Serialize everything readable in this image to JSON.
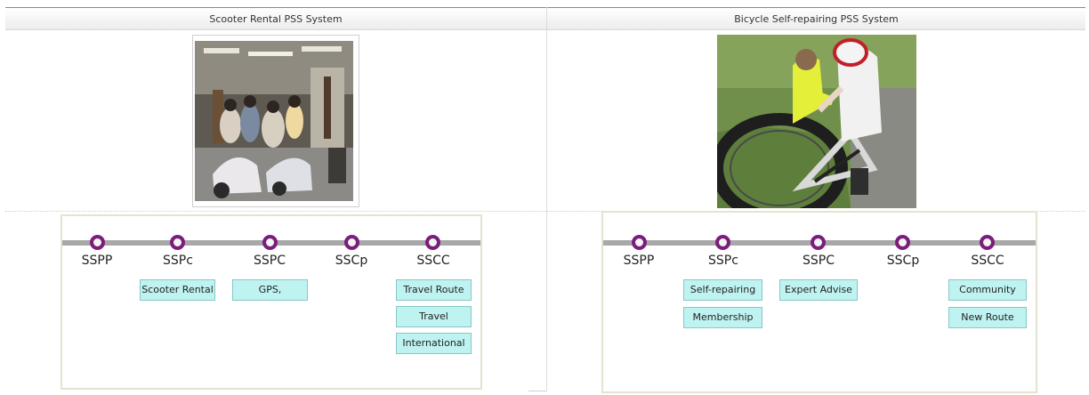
{
  "left_panel": {
    "title": "Scooter Rental PSS System",
    "photo_icon": "scooter-shop-photo",
    "stages": [
      "SSPP",
      "SSPc",
      "SSPC",
      "SSCp",
      "SSCC"
    ],
    "tags": {
      "sspc_small": [
        "Scooter Rental"
      ],
      "sspc_large": [
        "GPS,"
      ],
      "sscc": [
        "Travel Route",
        "Travel",
        "International"
      ]
    }
  },
  "right_panel": {
    "title": "Bicycle Self-repairing PSS System",
    "photo_icon": "bicycle-repair-photo",
    "stages": [
      "SSPP",
      "SSPc",
      "SSPC",
      "SSCp",
      "SSCC"
    ],
    "tags": {
      "sspc_small": [
        "Self-repairing",
        "Membership"
      ],
      "sspc_large": [
        "Expert Advise"
      ],
      "sscc": [
        "Community",
        "New Route"
      ]
    }
  },
  "colors": {
    "node_ring": "#7b1e7b",
    "track": "#a8a8a8",
    "tag_fill": "#bff3f1",
    "tag_border": "#86c8c6"
  }
}
